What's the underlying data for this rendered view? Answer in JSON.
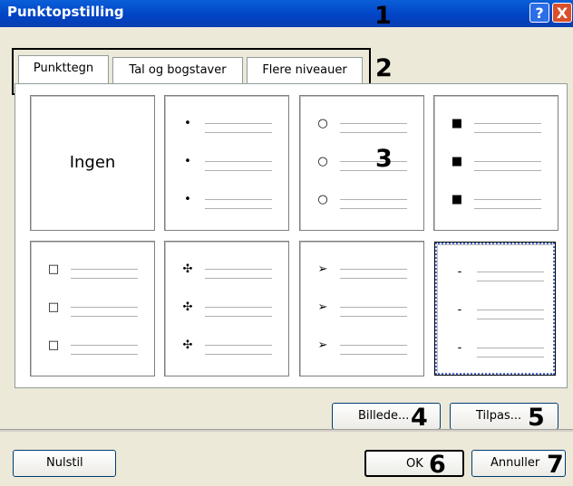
{
  "window": {
    "title": "Punktopstilling",
    "help": "?",
    "close": "X"
  },
  "callouts": [
    "1",
    "2",
    "3",
    "4",
    "5",
    "6",
    "7"
  ],
  "tabs": [
    {
      "label": "Punkttegn"
    },
    {
      "label": "Tal og bogstaver"
    },
    {
      "label": "Flere niveauer"
    }
  ],
  "gallery": {
    "none_label": "Ingen",
    "bullets": [
      "•",
      "○",
      "■",
      "□",
      "✣",
      "➢",
      "-"
    ]
  },
  "buttons": {
    "picture": "Billede...",
    "customize": "Tilpas...",
    "reset": "Nulstil",
    "ok": "OK",
    "cancel": "Annuller"
  }
}
